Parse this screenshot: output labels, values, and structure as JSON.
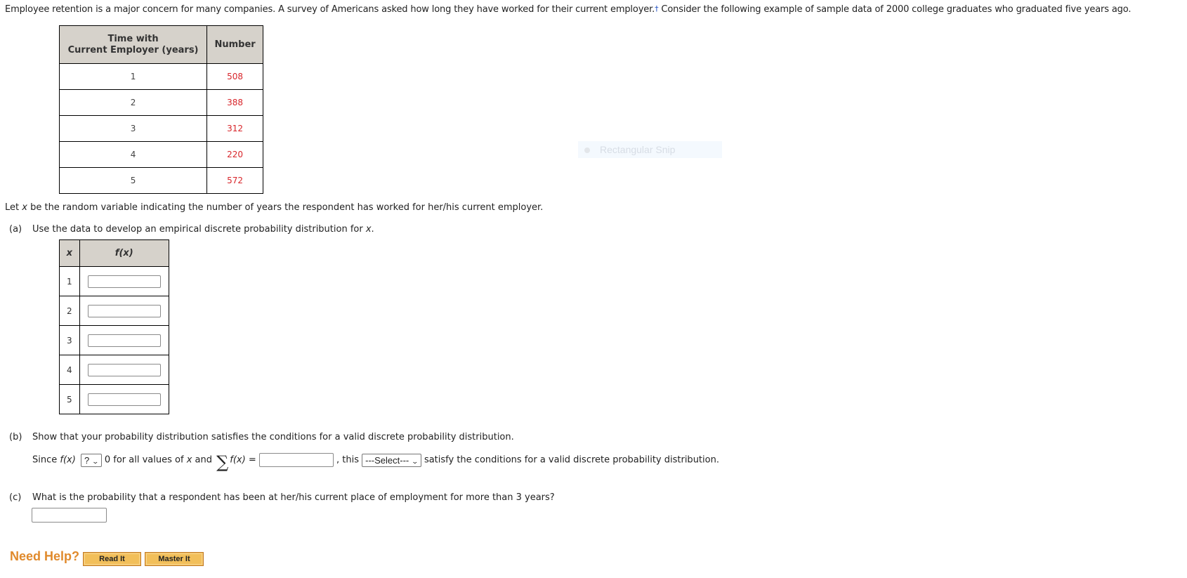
{
  "intro": {
    "text": "Employee retention is a major concern for many companies. A survey of Americans asked how long they have worked for their current employer.",
    "footnote_marker": "†",
    "text_after": " Consider the following example of sample data of 2000 college graduates who graduated five years ago."
  },
  "data_table": {
    "headers": [
      "Time with",
      "Current Employer (years)",
      "Number"
    ],
    "rows": [
      {
        "years": "1",
        "number": "508"
      },
      {
        "years": "2",
        "number": "388"
      },
      {
        "years": "3",
        "number": "312"
      },
      {
        "years": "4",
        "number": "220"
      },
      {
        "years": "5",
        "number": "572"
      }
    ],
    "number_color": "#d8262b"
  },
  "let_x": {
    "pre": "Let ",
    "var": "x",
    "post": " be the random variable indicating the number of years the respondent has worked for her/his current employer."
  },
  "part_a": {
    "label": "(a)",
    "text": "Use the data to develop an empirical discrete probability distribution for ",
    "var": "x",
    "end": ".",
    "table": {
      "x_header": "x",
      "f_header": "f(x)",
      "rows": [
        {
          "x": "1",
          "fx": ""
        },
        {
          "x": "2",
          "fx": ""
        },
        {
          "x": "3",
          "fx": ""
        },
        {
          "x": "4",
          "fx": ""
        },
        {
          "x": "5",
          "fx": ""
        }
      ]
    }
  },
  "part_b": {
    "label": "(b)",
    "text": "Show that your probability distribution satisfies the conditions for a valid discrete probability distribution.",
    "since": "Since ",
    "fx": "f(x)",
    "op_select": "?",
    "mid": "0 for all values of ",
    "var": "x",
    "and": " and ",
    "sigma": "∑",
    "fx2": "f(x)",
    "eq": " =",
    "sum_value": "",
    "this": ", this",
    "verdict_select": "---Select---",
    "end": "satisfy the conditions for a valid discrete probability distribution."
  },
  "part_c": {
    "label": "(c)",
    "text": "What is the probability that a respondent has been at her/his current place of employment for more than 3 years?",
    "answer": ""
  },
  "help": {
    "label": "Need Help?",
    "read_it": "Read It",
    "master_it": "Master It"
  },
  "overlay": {
    "snip_label": "Rectangular Snip"
  }
}
